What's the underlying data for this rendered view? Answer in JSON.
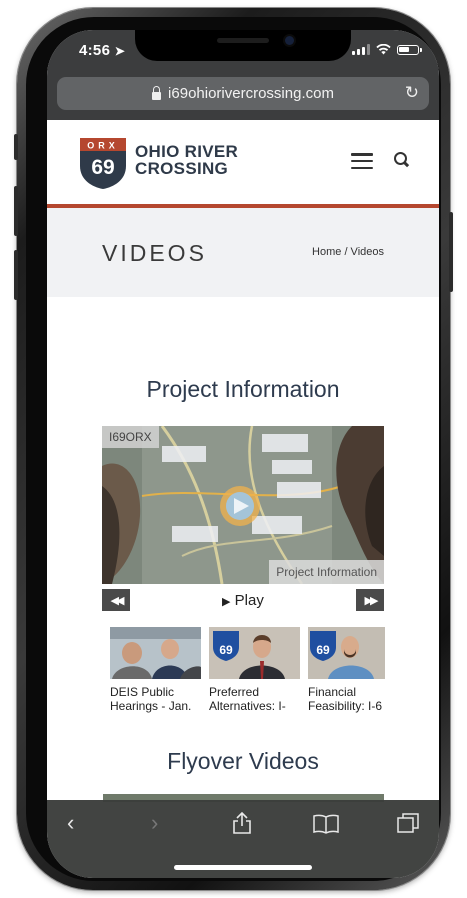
{
  "status": {
    "time": "4:56"
  },
  "browser": {
    "url": "i69ohiorivercrossing.com"
  },
  "logo": {
    "badge_top": "ORX",
    "badge_number": "69",
    "line1": "OHIO RIVER",
    "line2": "CROSSING"
  },
  "banner": {
    "title": "VIDEOS",
    "breadcrumb": "Home / Videos"
  },
  "sections": {
    "project": "Project Information",
    "flyover": "Flyover Videos"
  },
  "player": {
    "channel_tag": "I69ORX",
    "caption": "Project Information",
    "play_label": "Play",
    "prev_icon": "rewind-icon",
    "next_icon": "fast-forward-icon"
  },
  "playlist": [
    {
      "label1": "DEIS Public",
      "label2": "Hearings - Jan."
    },
    {
      "label1": "Preferred",
      "label2": "Alternatives: I-"
    },
    {
      "label1": "Financial",
      "label2": "Feasibility: I-6"
    }
  ],
  "colors": {
    "accent": "#b5472f",
    "navy": "#2f3a49",
    "chrome": "#3c3d3e"
  }
}
